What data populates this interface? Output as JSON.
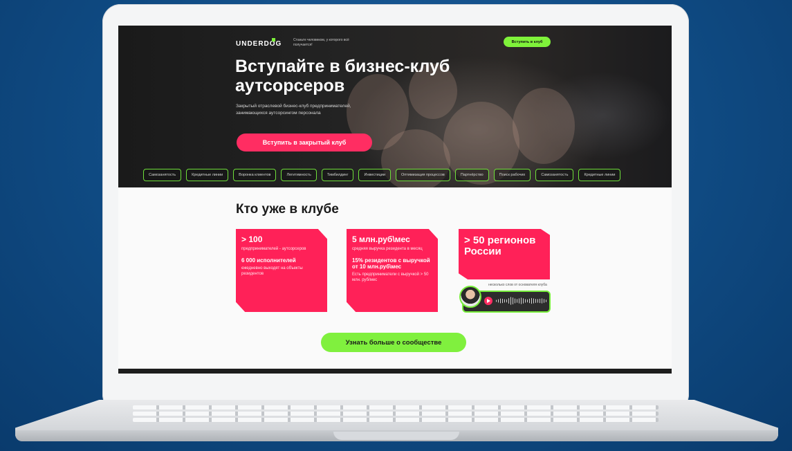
{
  "site": {
    "logo": "UNDERDOG",
    "tagline": "Станьте человеком, у которого всё получается!",
    "join_small_button": "Вступить в клуб"
  },
  "hero": {
    "title": "Вступайте в бизнес-клуб аутсорсеров",
    "subtitle": "Закрытый отраслевой бизнес-клуб предпринимателей, занимающихся аутсорсингом персонала",
    "cta": "Вступить в закрытый клуб",
    "tags": [
      "Самозанятость",
      "Кредитные линии",
      "Воронка клиентов",
      "Легитимность",
      "Тимбилдинг",
      "Инвестиции",
      "Оптимизация процессов",
      "Партнёрство",
      "Поиск рабочих",
      "Самозанятость",
      "Кредитные линии"
    ]
  },
  "club": {
    "title": "Кто уже в клубе",
    "cards": [
      {
        "big": "> 100",
        "small": "предпринимателей - аутсорсеров",
        "mid": "6 000 исполнителей",
        "small2": "ежедневно выходят на объекты резидентов"
      },
      {
        "big": "5 млн.руб\\мес",
        "small": "средняя выручка резидента в месяц",
        "mid": "15% резидентов с выручкой от 10 млн.руб\\мес",
        "small2": "Есть предприниматели с выручкой > 50 млн. руб/мес"
      },
      {
        "big": "> 50 регионов России"
      }
    ],
    "audio_caption": "несколько слов от основателя клуба",
    "more_button": "Узнать больше о сообществе"
  },
  "colors": {
    "accent_pink": "#ff2158",
    "accent_green": "#7ff23a",
    "background_blue": "#0f4a82"
  }
}
